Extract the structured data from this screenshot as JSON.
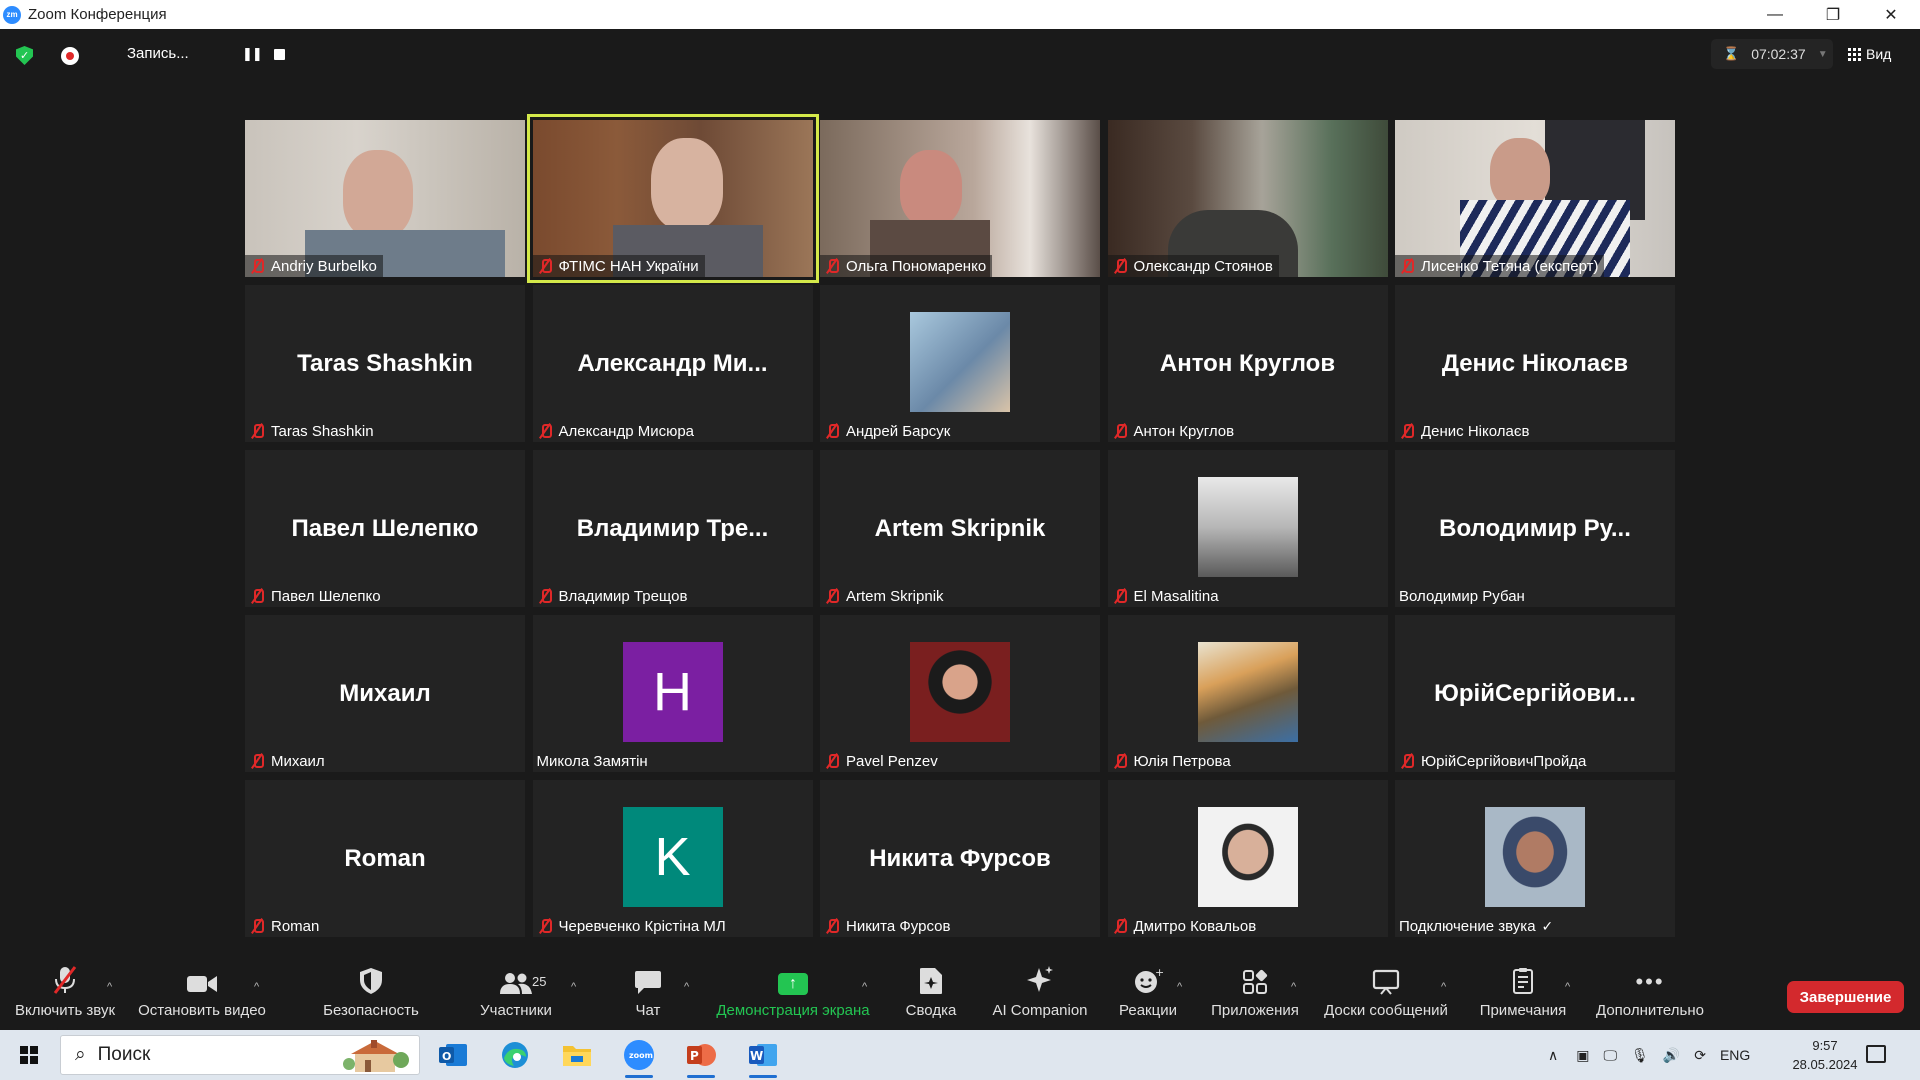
{
  "window": {
    "title": "Zoom Конференция",
    "app_icon_text": "zm"
  },
  "topbar": {
    "recording_label": "Запись...",
    "timer": "07:02:37",
    "view_label": "Вид"
  },
  "tiles": [
    {
      "name": "Andriy Burbelko",
      "muted": true,
      "kind": "video"
    },
    {
      "name": "ФТІМС НАН України",
      "muted": true,
      "kind": "video",
      "active_speaker": true
    },
    {
      "name": "Ольга Пономаренко",
      "muted": true,
      "kind": "video"
    },
    {
      "name": "Олександр Стоянов",
      "muted": true,
      "kind": "video"
    },
    {
      "name": "Лисенко Тетяна (експерт)",
      "muted": true,
      "kind": "video"
    },
    {
      "name": "Taras Shashkin",
      "display": "Taras Shashkin",
      "muted": true,
      "kind": "name"
    },
    {
      "name": "Александр Мисюра",
      "display": "Александр  Ми...",
      "muted": true,
      "kind": "name"
    },
    {
      "name": "Андрей Барсук",
      "muted": true,
      "kind": "photo"
    },
    {
      "name": "Антон Круглов",
      "display": "Антон Круглов",
      "muted": true,
      "kind": "name"
    },
    {
      "name": "Денис Ніколаєв",
      "display": "Денис Ніколаєв",
      "muted": true,
      "kind": "name"
    },
    {
      "name": "Павел Шелепко",
      "display": "Павел Шелепко",
      "muted": true,
      "kind": "name"
    },
    {
      "name": "Владимир Трещов",
      "display": "Владимир  Тре...",
      "muted": true,
      "kind": "name"
    },
    {
      "name": "Artem Skripnik",
      "display": "Artem Skripnik",
      "muted": true,
      "kind": "name"
    },
    {
      "name": "El Masalitina",
      "muted": true,
      "kind": "photo"
    },
    {
      "name": "Володимир Рубан",
      "display": "Володимир  Ру...",
      "muted": false,
      "kind": "name"
    },
    {
      "name": "Михаил",
      "display": "Михаил",
      "muted": true,
      "kind": "name"
    },
    {
      "name": "Микола Замятін",
      "muted": false,
      "kind": "letter",
      "letter": "H",
      "color": "#7b1fa2"
    },
    {
      "name": "Pavel Penzev",
      "muted": true,
      "kind": "photo"
    },
    {
      "name": "Юлія Петрова",
      "muted": true,
      "kind": "photo"
    },
    {
      "name": "ЮрійСергійовичПройда",
      "display": "ЮрійСергійови...",
      "muted": true,
      "kind": "name"
    },
    {
      "name": "Roman",
      "display": "Roman",
      "muted": true,
      "kind": "name"
    },
    {
      "name": "Черевченко Крістіна МЛ",
      "muted": true,
      "kind": "letter",
      "letter": "K",
      "color": "#00897b"
    },
    {
      "name": "Никита Фурсов",
      "display": "Никита Фурсов",
      "muted": true,
      "kind": "name"
    },
    {
      "name": "Дмитро Ковальов",
      "muted": true,
      "kind": "photo"
    },
    {
      "name": "Подключение звука",
      "muted": false,
      "kind": "photo",
      "connecting": true
    }
  ],
  "controls": {
    "audio": "Включить звук",
    "video": "Остановить видео",
    "security": "Безопасность",
    "participants": "Участники",
    "participants_count": "25",
    "chat": "Чат",
    "share": "Демонстрация экрана",
    "summary": "Сводка",
    "ai": "AI Companion",
    "reactions": "Реакции",
    "apps": "Приложения",
    "whiteboards": "Доски сообщений",
    "notes": "Примечания",
    "more": "Дополнительно",
    "end": "Завершение"
  },
  "taskbar": {
    "search_placeholder": "Поиск",
    "language": "ENG",
    "time": "9:57",
    "date": "28.05.2024",
    "apps": [
      "outlook-icon",
      "edge-icon",
      "file-explorer-icon",
      "zoom-icon",
      "powerpoint-icon",
      "word-icon"
    ]
  },
  "colors": {
    "accent_green": "#23c552",
    "end_red": "#d3292d",
    "active_outline": "#d4e94a",
    "muted_red": "#e02828"
  }
}
